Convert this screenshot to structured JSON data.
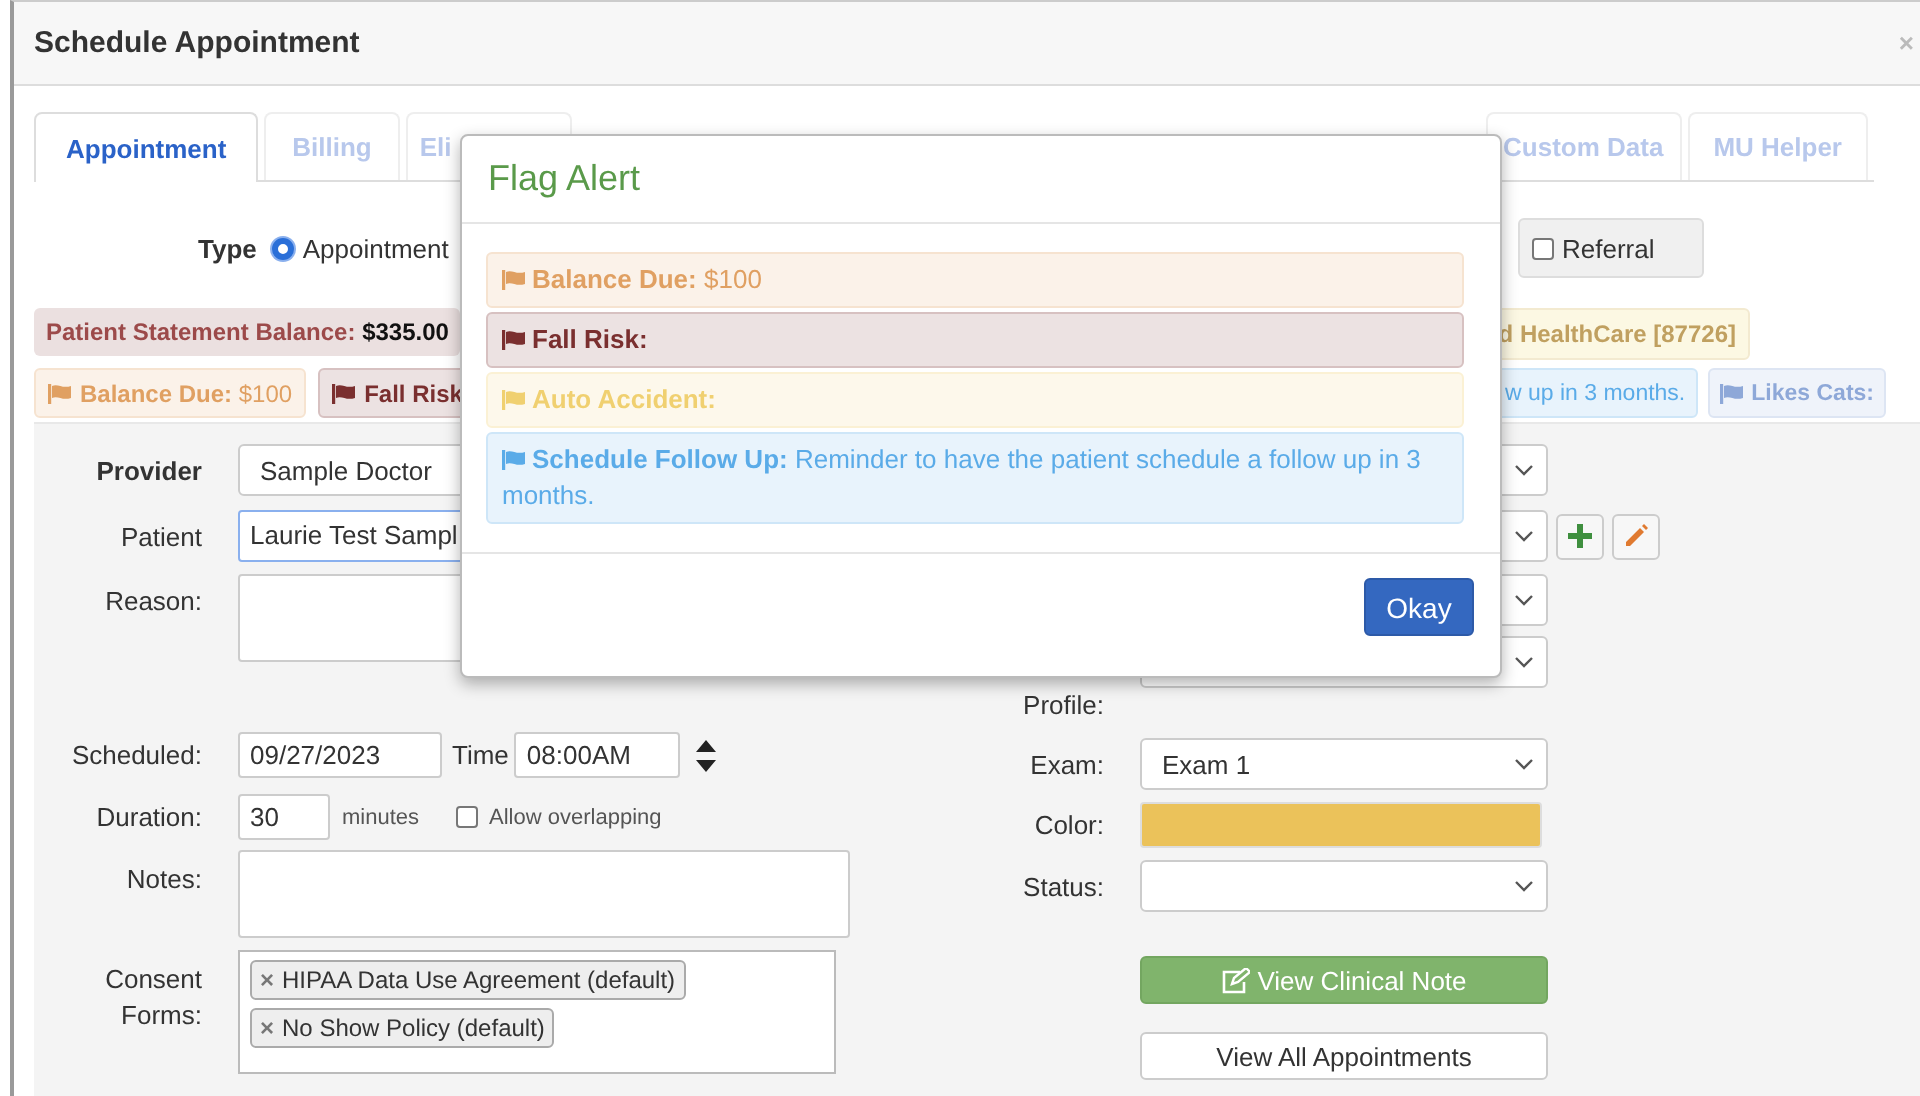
{
  "dialog": {
    "title": "Schedule Appointment",
    "close": "×"
  },
  "tabs": [
    {
      "label": "Appointment",
      "selected": true
    },
    {
      "label": "Billing",
      "selected": false
    },
    {
      "label": "Eli",
      "selected": false
    },
    {
      "label": "Custom Data",
      "selected": false
    },
    {
      "label": "MU Helper",
      "selected": false
    }
  ],
  "type": {
    "label": "Type",
    "radio": {
      "label": "Appointment",
      "selected": true
    },
    "referral": {
      "label": "Referral",
      "checked": false
    }
  },
  "banners": [
    {
      "kind": "balance",
      "label": "Patient Statement Balance:",
      "value": "$335.00"
    },
    {
      "kind": "insurance",
      "text": "d HealthCare [87726]"
    }
  ],
  "flags_left": [
    {
      "label": "Balance Due:",
      "text": "$100",
      "color": "#e0a062"
    },
    {
      "label": "Fall Risk:",
      "color": "#7a2f2f"
    }
  ],
  "flags_right": [
    {
      "text": "w up in 3 months.",
      "color": "#5aabe8"
    },
    {
      "label": "Likes Cats:",
      "color": "#8ea8d8"
    }
  ],
  "form_left": {
    "provider": {
      "label": "Provider",
      "value": "Sample Doctor"
    },
    "patient": {
      "label": "Patient",
      "value": "Laurie Test Sampl"
    },
    "reason": {
      "label": "Reason:"
    },
    "scheduled": {
      "label": "Scheduled:",
      "date": "09/27/2023",
      "time_label": "Time",
      "time": "08:00AM"
    },
    "duration": {
      "label": "Duration:",
      "value": "30",
      "unit": "minutes",
      "overlap": {
        "label": "Allow overlapping",
        "checked": false
      }
    },
    "notes": {
      "label": "Notes:"
    },
    "consent": {
      "label": "Consent Forms:",
      "tags": [
        {
          "label": "HIPAA Data Use Agreement (default)",
          "remove": "×"
        },
        {
          "label": "No Show Policy (default)",
          "remove": "×"
        }
      ]
    }
  },
  "form_right": {
    "selects": [
      {
        "kind": "select"
      },
      {
        "kind": "select_with_buttons"
      },
      {
        "kind": "select"
      },
      {
        "kind": "select",
        "label": "Profile:"
      }
    ],
    "exam": {
      "label": "Exam:",
      "value": "Exam 1"
    },
    "color": {
      "label": "Color:",
      "color": "#ebc25a"
    },
    "status": {
      "label": "Status:"
    },
    "clinical_note": "View Clinical Note",
    "all_appointments": "View All Appointments"
  },
  "modal": {
    "title": "Flag Alert",
    "alerts": [
      {
        "label": "Balance Due:",
        "text": "$100",
        "color": "#e0a062"
      },
      {
        "label": "Fall Risk:",
        "color": "#7a2f2f"
      },
      {
        "label": "Auto Accident:",
        "color": "#f0d070"
      },
      {
        "label": "Schedule Follow Up:",
        "text": "Reminder to have the patient schedule a follow up in 3 months.",
        "color": "#5aabe8"
      }
    ],
    "button": "Okay"
  }
}
